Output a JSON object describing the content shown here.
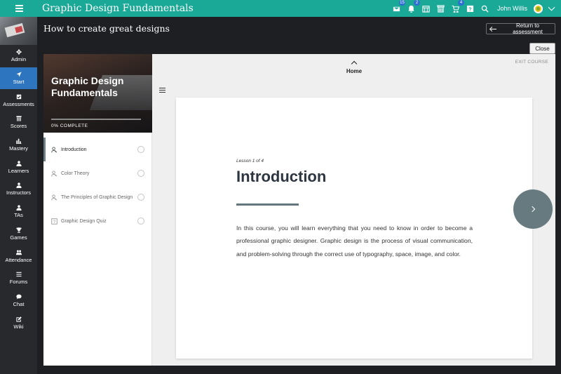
{
  "topbar": {
    "app_title": "Graphic Design Fundamentals",
    "badges": {
      "inbox": "15",
      "notifications": "2",
      "cart": "4"
    },
    "user_name": "John Willis",
    "accent_color": "#1aa897"
  },
  "leftnav": {
    "items": [
      {
        "label": "Admin",
        "icon": "gear-icon"
      },
      {
        "label": "Start",
        "icon": "navigate-icon",
        "active": true
      },
      {
        "label": "Assessments",
        "icon": "checkbox-icon"
      },
      {
        "label": "Scores",
        "icon": "gradebook-icon"
      },
      {
        "label": "Mastery",
        "icon": "bar-chart-icon"
      },
      {
        "label": "Learners",
        "icon": "person-icon"
      },
      {
        "label": "Instructors",
        "icon": "person-icon"
      },
      {
        "label": "TAs",
        "icon": "person-icon"
      },
      {
        "label": "Games",
        "icon": "trophy-icon"
      },
      {
        "label": "Attendance",
        "icon": "group-icon"
      },
      {
        "label": "Forums",
        "icon": "list-icon"
      },
      {
        "label": "Chat",
        "icon": "chat-icon"
      },
      {
        "label": "Wiki",
        "icon": "edit-icon"
      }
    ]
  },
  "header": {
    "page_title": "How to create great designs",
    "return_label": "Return to assessment",
    "close_label": "Close"
  },
  "outline": {
    "course_title": "Graphic Design Fundamentals",
    "progress_label": "0% COMPLETE",
    "progress_percent": 0,
    "lessons": [
      {
        "label": "Introduction",
        "icon": "lesson-icon"
      },
      {
        "label": "Color Theory",
        "icon": "lesson-icon"
      },
      {
        "label": "The Principles of Graphic Design",
        "icon": "lesson-icon"
      },
      {
        "label": "Graphic Design Quiz",
        "icon": "quiz-icon"
      }
    ]
  },
  "content": {
    "home_label": "Home",
    "exit_label": "EXIT COURSE",
    "lesson_count": "Lesson 1 of 4",
    "lesson_title": "Introduction",
    "body": "In this course, you will learn everything that you need to know in order to become a professional graphic designer. Graphic design is the process of visual communication, and problem-solving through the correct use of typography, space, image, and color."
  }
}
